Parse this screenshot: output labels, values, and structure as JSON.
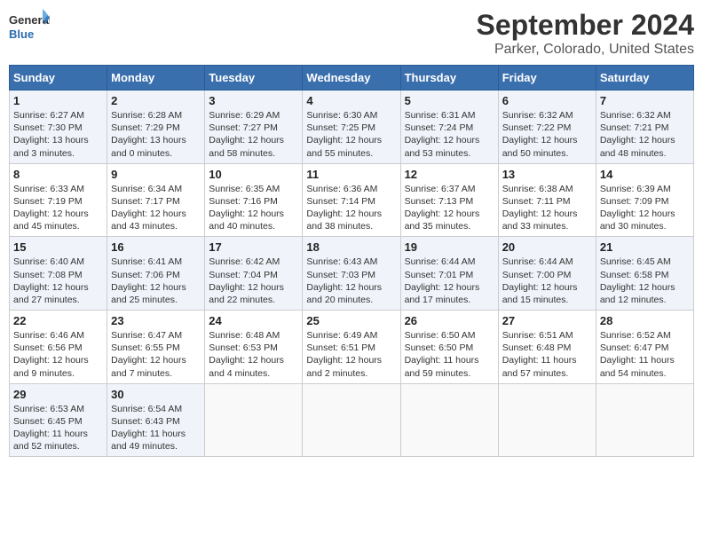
{
  "logo": {
    "general": "General",
    "blue": "Blue"
  },
  "title": "September 2024",
  "subtitle": "Parker, Colorado, United States",
  "days_of_week": [
    "Sunday",
    "Monday",
    "Tuesday",
    "Wednesday",
    "Thursday",
    "Friday",
    "Saturday"
  ],
  "weeks": [
    [
      {
        "day": "1",
        "sunrise": "6:27 AM",
        "sunset": "7:30 PM",
        "daylight": "13 hours and 3 minutes."
      },
      {
        "day": "2",
        "sunrise": "6:28 AM",
        "sunset": "7:29 PM",
        "daylight": "13 hours and 0 minutes."
      },
      {
        "day": "3",
        "sunrise": "6:29 AM",
        "sunset": "7:27 PM",
        "daylight": "12 hours and 58 minutes."
      },
      {
        "day": "4",
        "sunrise": "6:30 AM",
        "sunset": "7:25 PM",
        "daylight": "12 hours and 55 minutes."
      },
      {
        "day": "5",
        "sunrise": "6:31 AM",
        "sunset": "7:24 PM",
        "daylight": "12 hours and 53 minutes."
      },
      {
        "day": "6",
        "sunrise": "6:32 AM",
        "sunset": "7:22 PM",
        "daylight": "12 hours and 50 minutes."
      },
      {
        "day": "7",
        "sunrise": "6:32 AM",
        "sunset": "7:21 PM",
        "daylight": "12 hours and 48 minutes."
      }
    ],
    [
      {
        "day": "8",
        "sunrise": "6:33 AM",
        "sunset": "7:19 PM",
        "daylight": "12 hours and 45 minutes."
      },
      {
        "day": "9",
        "sunrise": "6:34 AM",
        "sunset": "7:17 PM",
        "daylight": "12 hours and 43 minutes."
      },
      {
        "day": "10",
        "sunrise": "6:35 AM",
        "sunset": "7:16 PM",
        "daylight": "12 hours and 40 minutes."
      },
      {
        "day": "11",
        "sunrise": "6:36 AM",
        "sunset": "7:14 PM",
        "daylight": "12 hours and 38 minutes."
      },
      {
        "day": "12",
        "sunrise": "6:37 AM",
        "sunset": "7:13 PM",
        "daylight": "12 hours and 35 minutes."
      },
      {
        "day": "13",
        "sunrise": "6:38 AM",
        "sunset": "7:11 PM",
        "daylight": "12 hours and 33 minutes."
      },
      {
        "day": "14",
        "sunrise": "6:39 AM",
        "sunset": "7:09 PM",
        "daylight": "12 hours and 30 minutes."
      }
    ],
    [
      {
        "day": "15",
        "sunrise": "6:40 AM",
        "sunset": "7:08 PM",
        "daylight": "12 hours and 27 minutes."
      },
      {
        "day": "16",
        "sunrise": "6:41 AM",
        "sunset": "7:06 PM",
        "daylight": "12 hours and 25 minutes."
      },
      {
        "day": "17",
        "sunrise": "6:42 AM",
        "sunset": "7:04 PM",
        "daylight": "12 hours and 22 minutes."
      },
      {
        "day": "18",
        "sunrise": "6:43 AM",
        "sunset": "7:03 PM",
        "daylight": "12 hours and 20 minutes."
      },
      {
        "day": "19",
        "sunrise": "6:44 AM",
        "sunset": "7:01 PM",
        "daylight": "12 hours and 17 minutes."
      },
      {
        "day": "20",
        "sunrise": "6:44 AM",
        "sunset": "7:00 PM",
        "daylight": "12 hours and 15 minutes."
      },
      {
        "day": "21",
        "sunrise": "6:45 AM",
        "sunset": "6:58 PM",
        "daylight": "12 hours and 12 minutes."
      }
    ],
    [
      {
        "day": "22",
        "sunrise": "6:46 AM",
        "sunset": "6:56 PM",
        "daylight": "12 hours and 9 minutes."
      },
      {
        "day": "23",
        "sunrise": "6:47 AM",
        "sunset": "6:55 PM",
        "daylight": "12 hours and 7 minutes."
      },
      {
        "day": "24",
        "sunrise": "6:48 AM",
        "sunset": "6:53 PM",
        "daylight": "12 hours and 4 minutes."
      },
      {
        "day": "25",
        "sunrise": "6:49 AM",
        "sunset": "6:51 PM",
        "daylight": "12 hours and 2 minutes."
      },
      {
        "day": "26",
        "sunrise": "6:50 AM",
        "sunset": "6:50 PM",
        "daylight": "11 hours and 59 minutes."
      },
      {
        "day": "27",
        "sunrise": "6:51 AM",
        "sunset": "6:48 PM",
        "daylight": "11 hours and 57 minutes."
      },
      {
        "day": "28",
        "sunrise": "6:52 AM",
        "sunset": "6:47 PM",
        "daylight": "11 hours and 54 minutes."
      }
    ],
    [
      {
        "day": "29",
        "sunrise": "6:53 AM",
        "sunset": "6:45 PM",
        "daylight": "11 hours and 52 minutes."
      },
      {
        "day": "30",
        "sunrise": "6:54 AM",
        "sunset": "6:43 PM",
        "daylight": "11 hours and 49 minutes."
      },
      null,
      null,
      null,
      null,
      null
    ]
  ],
  "labels": {
    "sunrise": "Sunrise:",
    "sunset": "Sunset:",
    "daylight": "Daylight:"
  }
}
